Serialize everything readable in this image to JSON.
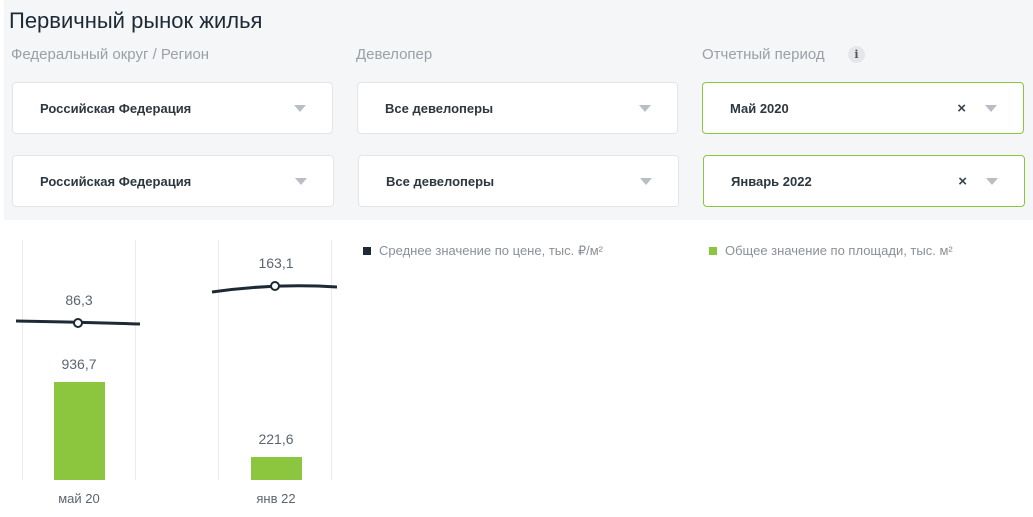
{
  "page": {
    "title": "Первичный рынок жилья"
  },
  "filters": {
    "region_label": "Федеральный округ / Регион",
    "developer_label": "Девелопер",
    "period_label": "Отчетный период",
    "info_icon": "i",
    "rows": [
      {
        "region": "Российская Федерация",
        "developer": "Все девелоперы",
        "period": "Май 2020"
      },
      {
        "region": "Российская Федерация",
        "developer": "Все девелоперы",
        "period": "Январь 2022"
      }
    ],
    "clear_symbol": "×"
  },
  "legend": {
    "price": {
      "label": "Среднее значение по цене, тыс. ₽/м²",
      "color": "#1d2a35"
    },
    "area": {
      "label": "Общее значение по площади, тыс. м²",
      "color": "#8cc63f"
    }
  },
  "chart_data": {
    "type": "bar",
    "categories": [
      "май 20",
      "янв 22"
    ],
    "series": [
      {
        "name": "Общее значение по площади, тыс. м²",
        "values": [
          936.7,
          221.6
        ],
        "labels": [
          "936,7",
          "221,6"
        ],
        "color": "#8cc63f"
      },
      {
        "name": "Среднее значение по цене, тыс. ₽/м²",
        "values": [
          86.3,
          163.1
        ],
        "labels": [
          "86,3",
          "163,1"
        ],
        "color": "#1d2a35"
      }
    ]
  }
}
